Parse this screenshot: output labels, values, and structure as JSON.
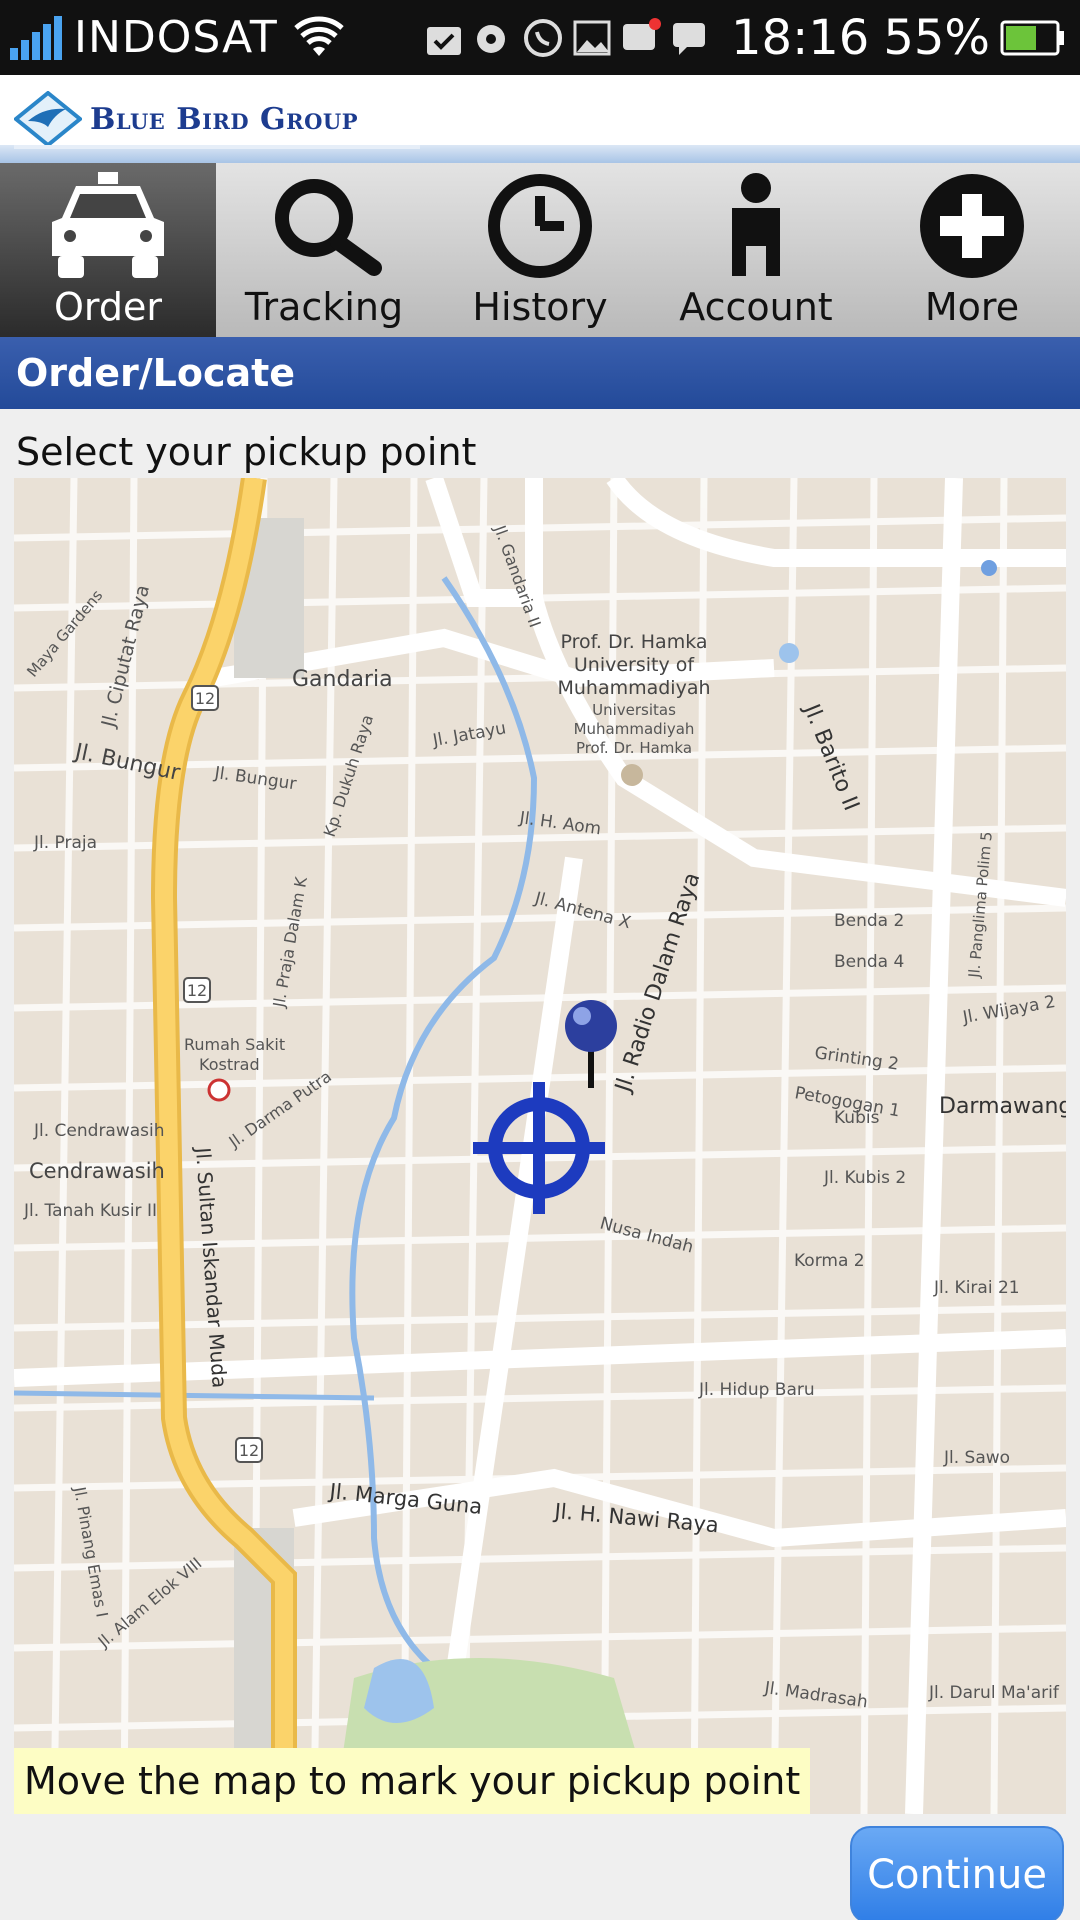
{
  "status_bar": {
    "carrier": "INDOSAT",
    "time": "18:16",
    "battery": "55%",
    "icons": [
      "signal-icon",
      "wifi-icon",
      "bag-icon",
      "sync-icon",
      "whatsapp-icon",
      "gallery-icon",
      "bbm-icon",
      "chat-icon",
      "battery-icon"
    ]
  },
  "brand": {
    "name": "Blue Bird Group",
    "icon": "bird-logo-icon"
  },
  "tabs": [
    {
      "label": "Order",
      "icon": "taxi-icon",
      "active": true
    },
    {
      "label": "Tracking",
      "icon": "search-icon",
      "active": false
    },
    {
      "label": "History",
      "icon": "clock-icon",
      "active": false
    },
    {
      "label": "Account",
      "icon": "person-icon",
      "active": false
    },
    {
      "label": "More",
      "icon": "plus-icon",
      "active": false
    }
  ],
  "section_title": "Order/Locate",
  "instruction": "Select your pickup point",
  "map": {
    "labels": {
      "gandaria": "Gandaria",
      "jl_bungur": "Jl. Bungur",
      "jl_bungur2": "Jl. Bungur",
      "jl_praja": "Jl. Praja",
      "jl_ciputat": "Jl. Ciputat Raya",
      "maya_gardens": "Maya Gardens",
      "univ": "Prof. Dr. Hamka",
      "univ2": "University of",
      "univ3": "Muhammadiyah",
      "univ4": "Universitas",
      "univ5": "Muhammadiyah",
      "univ6": "Prof. Dr. Hamka",
      "jl_gandaria": "Jl. Gandaria II",
      "jl_jatayu": "Jl. Jatayu",
      "jl_h_aom": "Jl. H. Aom",
      "jl_antena": "Jl. Antena X",
      "jl_radio_dalam": "Jl. Radio Dalam Raya",
      "jl_barito": "Jl. Barito II",
      "benda2": "Benda 2",
      "benda4": "Benda 4",
      "grinting": "Grinting 2",
      "petogogan": "Petogogan 1",
      "kubis": "Kubis",
      "darmawang": "Darmawang",
      "jl_kubis2": "Jl. Kubis 2",
      "korma2": "Korma 2",
      "jl_kirai": "Jl. Kirai 21",
      "rs_kostrad": "Rumah Sakit",
      "rs_kostrad2": "Kostrad",
      "jl_cendrawasih": "Jl. Cendrawasih",
      "cendrawasih": "Cendrawasih",
      "jl_tanah_kusir": "Jl. Tanah Kusir II",
      "jl_sultan": "Jl. Sultan Iskandar Muda",
      "jl_damar_putra": "Jl. Darma Putra",
      "jl_hidup_baru": "Jl. Hidup Baru",
      "jl_marga_guna": "Jl. Marga Guna",
      "jl_nawi_raya": "Jl. H. Nawi Raya",
      "jl_madrasah": "Jl. Madrasah",
      "jl_darul": "Jl. Darul Ma'arif",
      "jl_sawo": "Jl. Sawo",
      "jl_alam_elok": "Jl. Alam Elok VIII",
      "jl_pinang": "Jl. Pinang Emas I",
      "nusa_indah": "Nusa Indah",
      "jl_wijaya": "Jl. Wijaya 2",
      "jl_panglima": "Jl. Panglima Polim 5",
      "jl_kp_dukuh": "Kp. Dukuh Raya",
      "jl_praja_dalam": "Jl. Praja Dalam K",
      "road12": "12"
    },
    "hint": "Move the map to mark your pickup point"
  },
  "continue_label": "Continue",
  "colors": {
    "section_blue": "#2a4f9e",
    "accent_blue": "#2f7ee7",
    "hint_bg": "#fdfdc4",
    "map_bg": "#e9e1d6"
  }
}
